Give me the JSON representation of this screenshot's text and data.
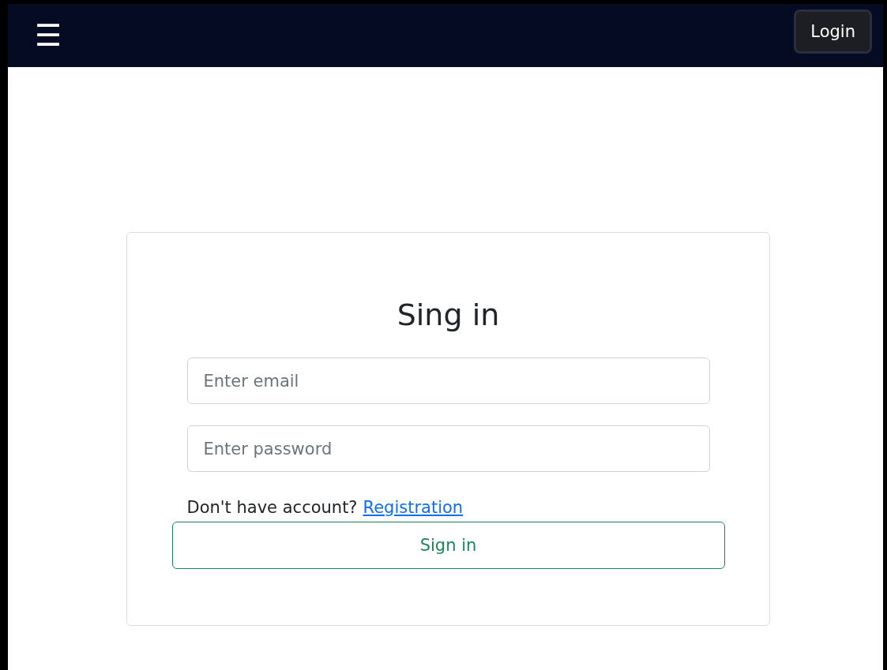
{
  "navbar": {
    "menu_icon": "☰",
    "login_button": "Login"
  },
  "form": {
    "title": "Sing in",
    "email": {
      "placeholder": "Enter email"
    },
    "password": {
      "placeholder": "Enter password"
    },
    "prompt": "Don't have account?",
    "link": "Registration",
    "submit": "Sign in"
  }
}
